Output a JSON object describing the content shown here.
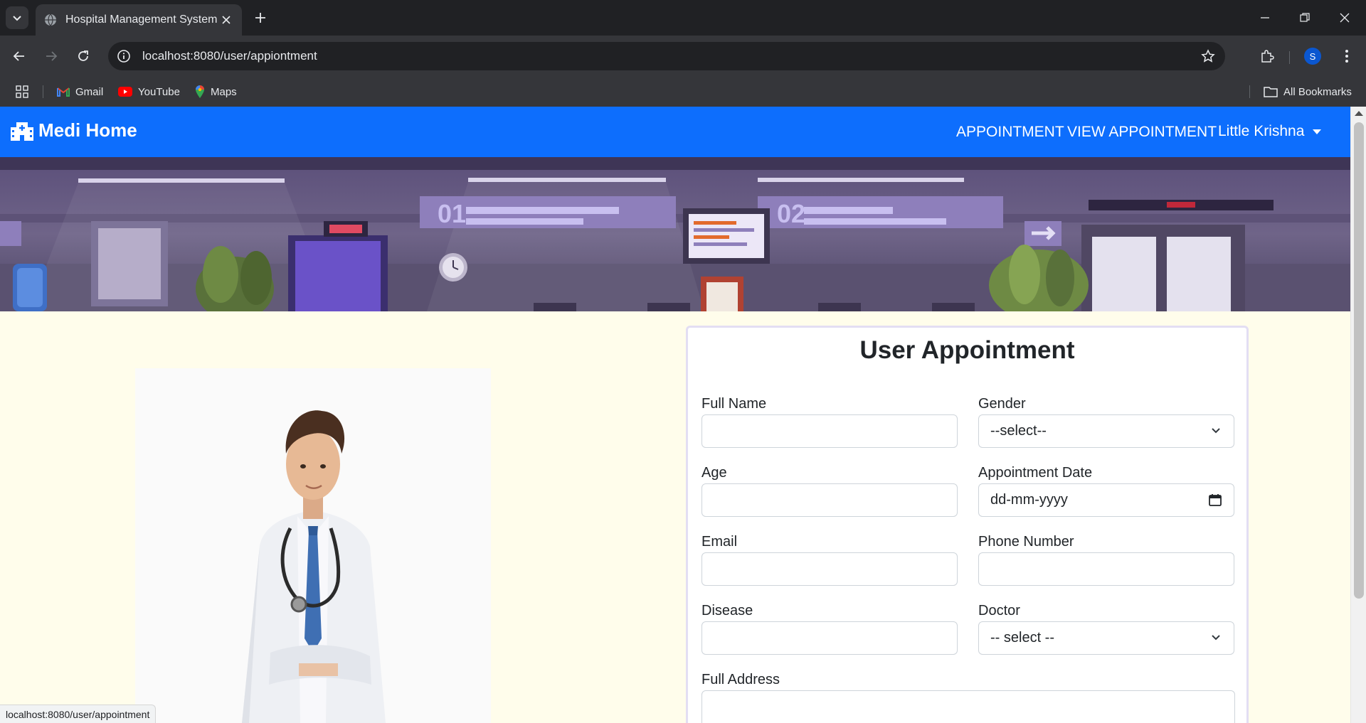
{
  "browser": {
    "tab_title": "Hospital Management System",
    "url": "localhost:8080/user/appiontment",
    "profile_initial": "S",
    "bookmarks": [
      {
        "label": "Gmail",
        "icon": "gmail-icon"
      },
      {
        "label": "YouTube",
        "icon": "youtube-icon"
      },
      {
        "label": "Maps",
        "icon": "maps-icon"
      }
    ],
    "all_bookmarks_label": "All Bookmarks",
    "status_url": "localhost:8080/user/appointment"
  },
  "navbar": {
    "brand": "Medi Home",
    "links": [
      "APPOINTMENT",
      "VIEW APPOINTMENT"
    ],
    "user": "Little Krishna",
    "color": "#0d6efd"
  },
  "form": {
    "title": "User Appointment",
    "fields": {
      "full_name": {
        "label": "Full Name",
        "value": ""
      },
      "gender": {
        "label": "Gender",
        "value": "--select--"
      },
      "age": {
        "label": "Age",
        "value": ""
      },
      "appointment_date": {
        "label": "Appointment Date",
        "value": "dd-mm-yyyy"
      },
      "email": {
        "label": "Email",
        "value": ""
      },
      "phone": {
        "label": "Phone Number",
        "value": ""
      },
      "disease": {
        "label": "Disease",
        "value": ""
      },
      "doctor": {
        "label": "Doctor",
        "value": "-- select --"
      },
      "address": {
        "label": "Full Address",
        "value": ""
      }
    }
  },
  "colors": {
    "page_background": "#fffdeb",
    "chrome_dark": "#202124",
    "chrome_mid": "#35363a"
  }
}
